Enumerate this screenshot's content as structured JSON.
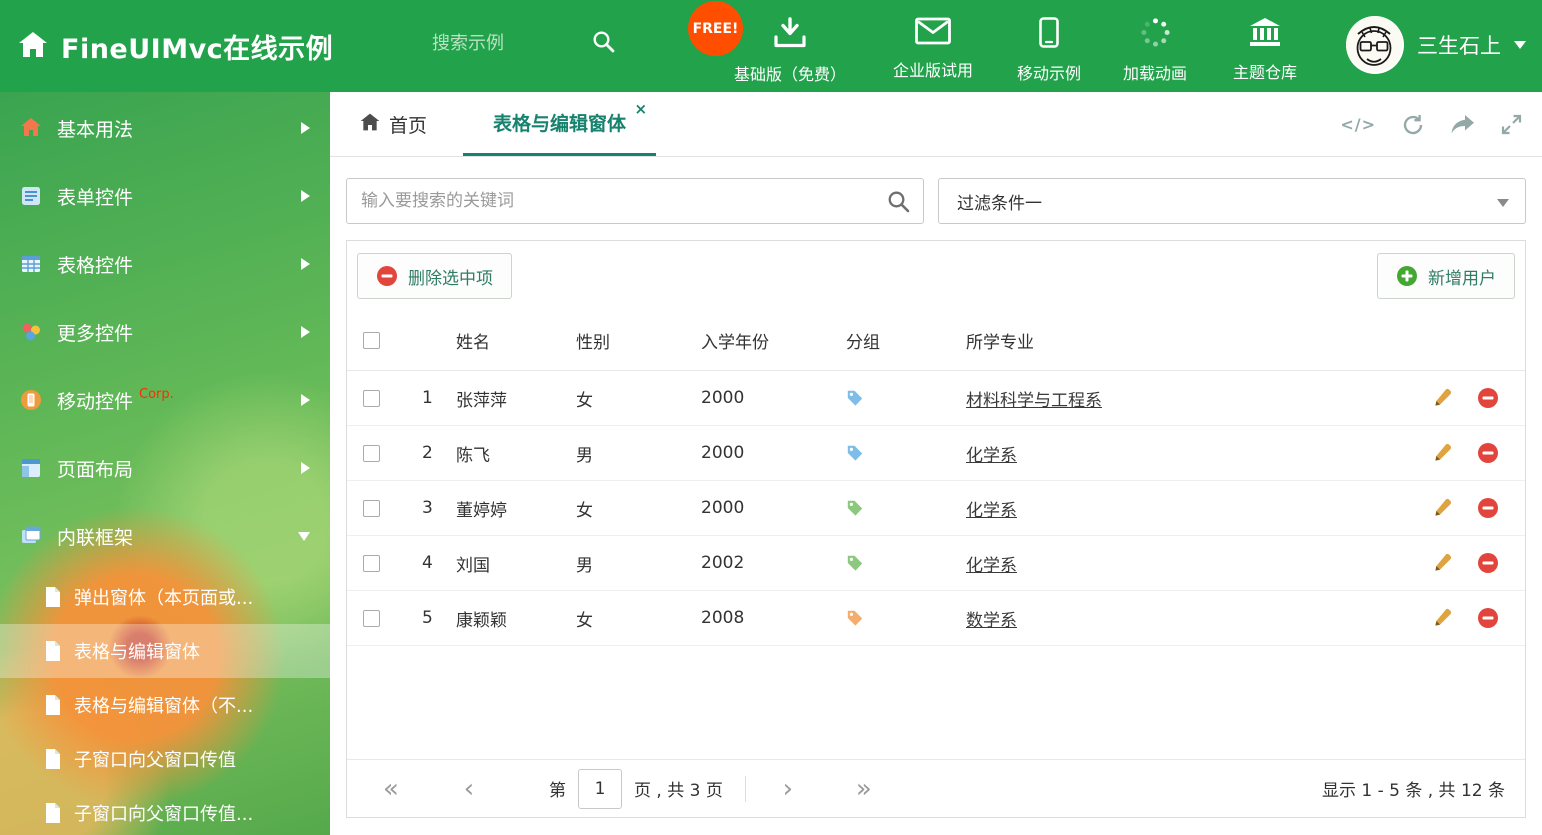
{
  "colors": {
    "header_green": "#21a24b",
    "accent_teal": "#17826e",
    "free_badge": "#ff4e00",
    "danger_red": "#e2453c",
    "success_green": "#43a832",
    "pencil_orange": "#dfa440"
  },
  "header": {
    "title": "FineUIMvc在线示例",
    "search_placeholder": "搜索示例",
    "free_badge": "FREE!",
    "nav": [
      {
        "label": "基础版（免费）",
        "icon": "download-icon"
      },
      {
        "label": "企业版试用",
        "icon": "envelope-icon"
      },
      {
        "label": "移动示例",
        "icon": "mobile-icon"
      },
      {
        "label": "加载动画",
        "icon": "spinner-icon"
      },
      {
        "label": "主题仓库",
        "icon": "bank-icon"
      }
    ],
    "user_name": "三生石上"
  },
  "sidebar": {
    "items": [
      {
        "label": "基本用法"
      },
      {
        "label": "表单控件"
      },
      {
        "label": "表格控件"
      },
      {
        "label": "更多控件"
      },
      {
        "label": "移动控件",
        "badge": "Corp."
      },
      {
        "label": "页面布局"
      },
      {
        "label": "内联框架"
      }
    ],
    "subitems": [
      {
        "label": "弹出窗体（本页面或..."
      },
      {
        "label": "表格与编辑窗体"
      },
      {
        "label": "表格与编辑窗体（不..."
      },
      {
        "label": "子窗口向父窗口传值"
      },
      {
        "label": "子窗口向父窗口传值..."
      }
    ]
  },
  "tabs": {
    "home_label": "首页",
    "active_label": "表格与编辑窗体",
    "close": "×",
    "tools": {
      "code": "</>"
    }
  },
  "filter": {
    "search_placeholder": "输入要搜索的关键词",
    "dropdown_value": "过滤条件一"
  },
  "toolbar": {
    "delete_label": "删除选中项",
    "add_label": "新增用户"
  },
  "table": {
    "columns": [
      "姓名",
      "性别",
      "入学年份",
      "分组",
      "所学专业"
    ],
    "rows": [
      {
        "num": "1",
        "name": "张萍萍",
        "gender": "女",
        "year": "2000",
        "tag_color": "#7dbde8",
        "major": "材料科学与工程系"
      },
      {
        "num": "2",
        "name": "陈飞",
        "gender": "男",
        "year": "2000",
        "tag_color": "#7dbde8",
        "major": "化学系"
      },
      {
        "num": "3",
        "name": "董婷婷",
        "gender": "女",
        "year": "2000",
        "tag_color": "#8cc87e",
        "major": "化学系"
      },
      {
        "num": "4",
        "name": "刘国",
        "gender": "男",
        "year": "2002",
        "tag_color": "#8cc87e",
        "major": "化学系"
      },
      {
        "num": "5",
        "name": "康颖颖",
        "gender": "女",
        "year": "2008",
        "tag_color": "#f3ad6d",
        "major": "数学系"
      }
    ]
  },
  "pagination": {
    "icons": {
      "first": "«",
      "prev": "‹",
      "next": "›",
      "last": "»"
    },
    "page_prefix": "第",
    "current_page": "1",
    "page_suffix": "页 , 共 3 页",
    "summary": "显示 1 - 5 条 , 共 12 条"
  }
}
